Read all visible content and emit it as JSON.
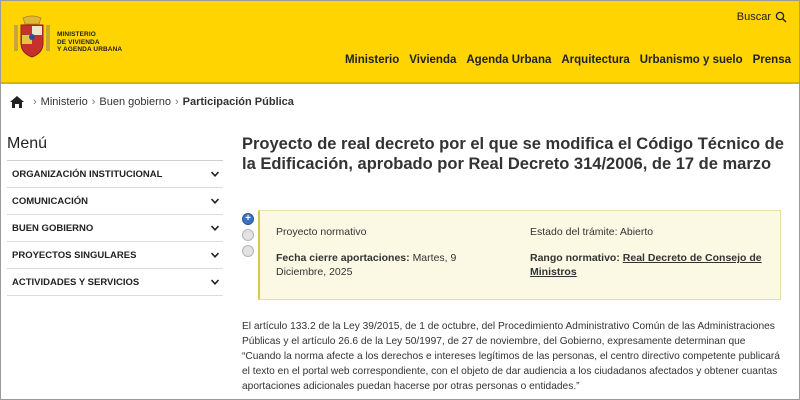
{
  "header": {
    "ministry_lines": [
      "MINISTERIO",
      "DE VIVIENDA",
      "Y AGENDA URBANA"
    ],
    "search_label": "Buscar",
    "nav": [
      "Ministerio",
      "Vivienda",
      "Agenda Urbana",
      "Arquitectura",
      "Urbanismo y suelo",
      "Prensa"
    ],
    "colors": {
      "header_bg": "#ffd400"
    }
  },
  "breadcrumb": {
    "items": [
      "Ministerio",
      "Buen gobierno"
    ],
    "current": "Participación Pública"
  },
  "sidebar": {
    "title": "Menú",
    "items": [
      "ORGANIZACIÓN INSTITUCIONAL",
      "COMUNICACIÓN",
      "BUEN GOBIERNO",
      "PROYECTOS SINGULARES",
      "ACTIVIDADES Y SERVICIOS"
    ]
  },
  "main": {
    "title": "Proyecto de real decreto por el que se modifica el Código Técnico de la Edificación, aprobado por Real Decreto 314/2006, de 17 de marzo",
    "info": {
      "type": "Proyecto normativo",
      "status": "Estado del trámite: Abierto",
      "closing_label": "Fecha cierre aportaciones:",
      "closing_value": "Martes, 9 Diciembre, 2025",
      "range_label": "Rango normativo:",
      "range_value": "Real Decreto de Consejo de Ministros"
    },
    "paragraph": "El artículo 133.2 de la Ley 39/2015, de 1 de octubre, del Procedimiento Administrativo Común de las Administraciones Públicas y el artículo 26.6 de la Ley 50/1997, de 27 de noviembre, del Gobierno, expresamente determinan que “Cuando la norma afecte a los derechos e intereses legítimos de las personas, el centro directivo competente publicará el texto en el portal web correspondiente, con el objeto de dar audiencia a los ciudadanos afectados y obtener cuantas aportaciones adicionales puedan hacerse por otras personas o entidades.”"
  }
}
